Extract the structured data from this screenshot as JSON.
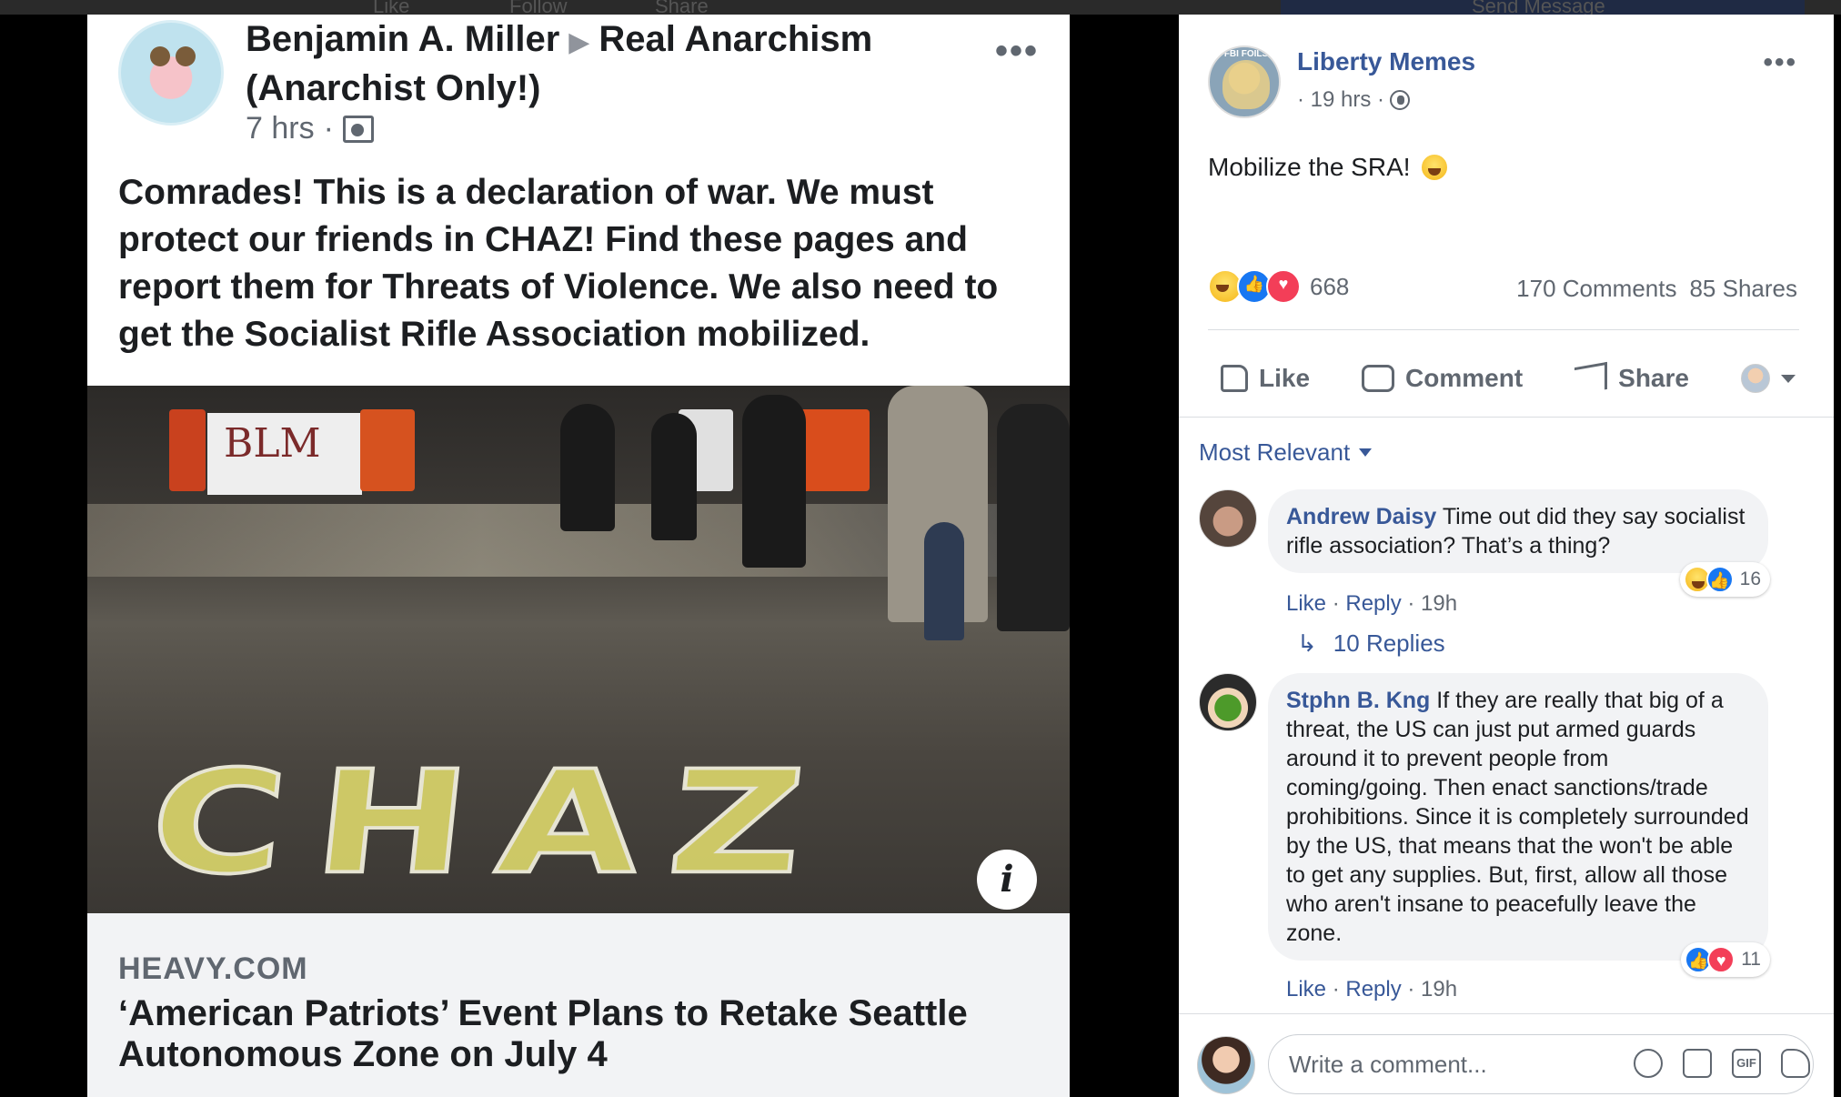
{
  "top_strip": {
    "items": [
      "Like",
      "Follow",
      "Share",
      "Send Message"
    ]
  },
  "shared_post": {
    "author": "Benjamin A. Miller",
    "group": "Real Anarchism (Anarchist Only!)",
    "time": "7 hrs",
    "text": "Comrades! This is a declaration of war. We must protect our friends in CHAZ! Find these pages and report them for Threats of Violence. We also need to get the Socialist Rifle Association mobilized.",
    "photo_sign_text": "BLM",
    "photo_ground_text": "CHAZ",
    "link_domain": "HEAVY.COM",
    "link_headline": "‘American Patriots’ Event Plans to Retake Seattle Autonomous Zone on July 4"
  },
  "post": {
    "page_name": "Liberty Memes",
    "time": "· 19 hrs ·",
    "avatar_caption": "FBI FOILS",
    "text": "Mobilize the SRA!",
    "reaction_count": "668",
    "comments": "170 Comments",
    "shares": "85 Shares",
    "actions": {
      "like": "Like",
      "comment": "Comment",
      "share": "Share"
    }
  },
  "comments_section": {
    "sort_label": "Most Relevant",
    "comments": [
      {
        "name": "Andrew Daisy",
        "text": "Time out did they say socialist rifle association? That’s a thing?",
        "reaction_count": "16",
        "like": "Like",
        "reply": "Reply",
        "time": "19h"
      },
      {
        "name": "Stphn B. Kng",
        "text": "If they are really that big of a threat, the US can just put armed guards around it to prevent people from coming/going. Then enact sanctions/trade prohibitions. Since it is completely surrounded by the US, that means that the won't be able to get any supplies. But, first, allow all those who aren't insane to peacefully leave the zone.",
        "reaction_count": "11",
        "like": "Like",
        "reply": "Reply",
        "time": "19h"
      }
    ],
    "replies_label": "10 Replies",
    "composer_placeholder": "Write a comment..."
  },
  "colors": {
    "link_blue": "#385898",
    "text": "#1c1e21",
    "secondary": "#606770",
    "like_blue": "#1877f2",
    "love_red": "#f33e58"
  }
}
